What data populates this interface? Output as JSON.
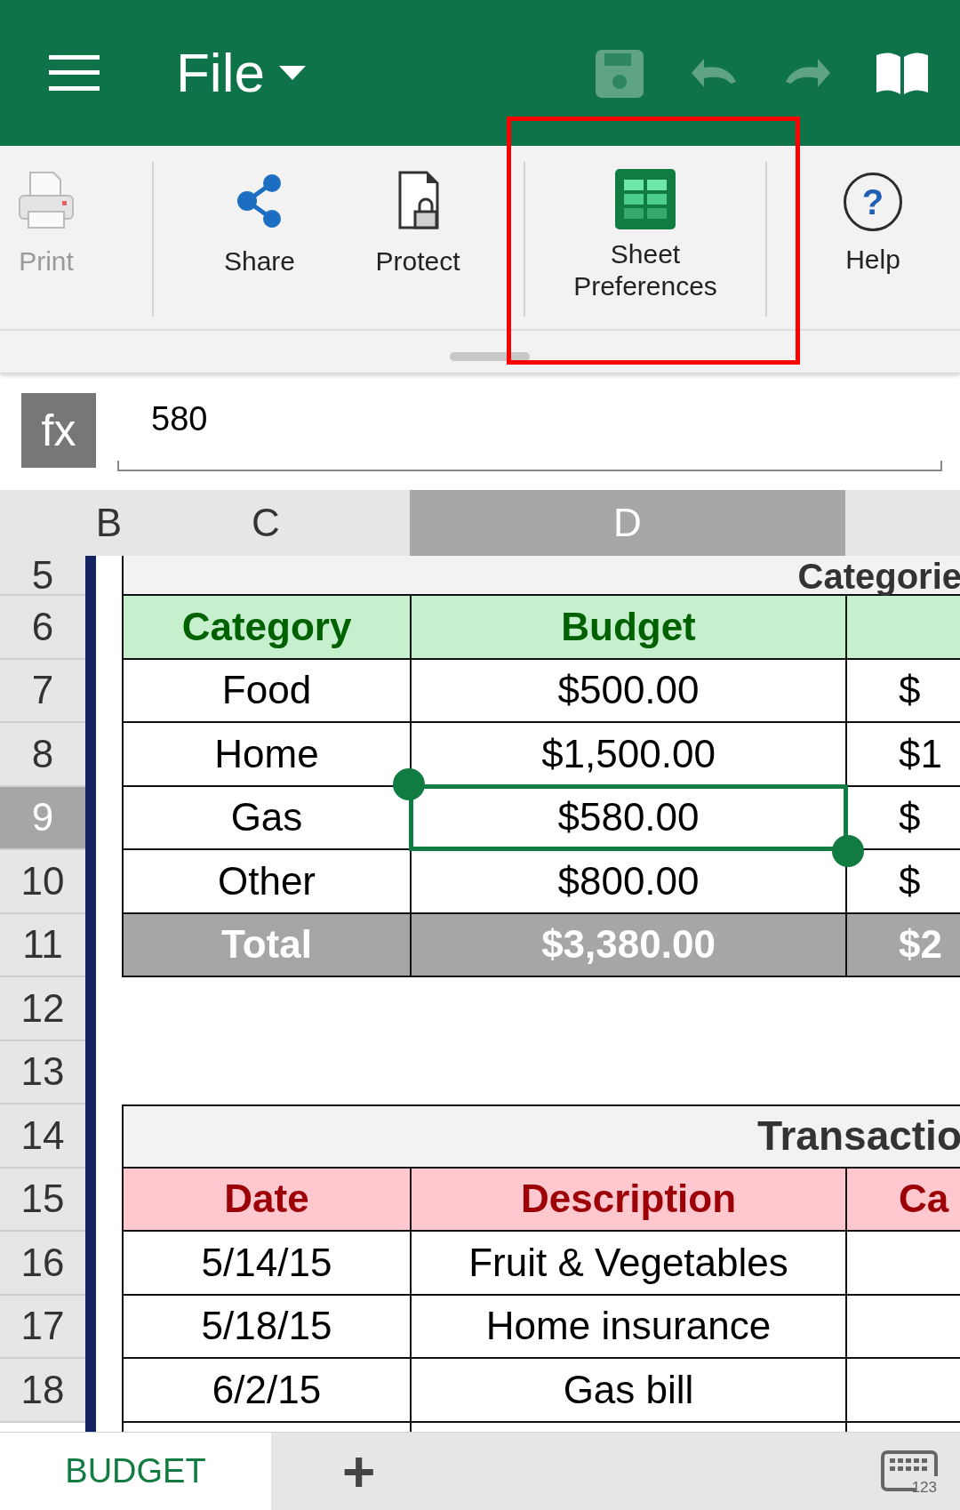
{
  "top_bar": {
    "menu_label": "File",
    "tools": [
      {
        "kind": "save",
        "disabled": true
      },
      {
        "kind": "undo",
        "disabled": true
      },
      {
        "kind": "redo",
        "disabled": true
      },
      {
        "kind": "book",
        "disabled": false
      }
    ]
  },
  "ribbon": {
    "items": [
      {
        "kind": "print",
        "label": "Print",
        "disabled": true,
        "highlighted": false,
        "divider_after": true
      },
      {
        "kind": "share",
        "label": "Share",
        "disabled": false,
        "highlighted": false,
        "divider_after": false
      },
      {
        "kind": "protect",
        "label": "Protect",
        "disabled": false,
        "highlighted": false,
        "divider_after": true
      },
      {
        "kind": "sheet",
        "label": "Sheet Preferences",
        "disabled": false,
        "highlighted": true,
        "divider_after": true
      },
      {
        "kind": "help",
        "label": "Help",
        "glyph": "?",
        "disabled": false,
        "highlighted": false,
        "divider_after": false
      }
    ]
  },
  "formula_bar": {
    "button": "fx",
    "value": "580"
  },
  "sheet": {
    "columns": [
      {
        "label": "B",
        "selected": false
      },
      {
        "label": "C",
        "selected": false
      },
      {
        "label": "D",
        "selected": true
      }
    ],
    "rows": [
      {
        "number": "5",
        "selected": false,
        "kind": "title",
        "title": "Categorie"
      },
      {
        "number": "6",
        "selected": false,
        "kind": "header",
        "color": "#c6efce",
        "cells": [
          "Category",
          "Budget"
        ]
      },
      {
        "number": "7",
        "selected": false,
        "kind": "data",
        "cells": [
          "Food",
          "$500.00",
          "$"
        ]
      },
      {
        "number": "8",
        "selected": false,
        "kind": "data",
        "cells": [
          "Home",
          "$1,500.00",
          "$1"
        ]
      },
      {
        "number": "9",
        "selected": true,
        "kind": "data",
        "cells": [
          "Gas",
          "$580.00",
          "$"
        ]
      },
      {
        "number": "10",
        "selected": false,
        "kind": "data",
        "cells": [
          "Other",
          "$800.00",
          "$"
        ]
      },
      {
        "number": "11",
        "selected": false,
        "kind": "total",
        "cells": [
          "Total",
          "$3,380.00",
          "$2"
        ]
      },
      {
        "number": "12",
        "selected": false,
        "kind": "empty"
      },
      {
        "number": "13",
        "selected": false,
        "kind": "empty"
      },
      {
        "number": "14",
        "selected": false,
        "kind": "title",
        "title": "Transactio"
      },
      {
        "number": "15",
        "selected": false,
        "kind": "header",
        "color": "#ffc7ce",
        "cells": [
          "Date",
          "Description",
          "Ca"
        ]
      },
      {
        "number": "16",
        "selected": false,
        "kind": "data",
        "cells": [
          "5/14/15",
          "Fruit & Vegetables"
        ]
      },
      {
        "number": "17",
        "selected": false,
        "kind": "data",
        "cells": [
          "5/18/15",
          "Home insurance"
        ]
      },
      {
        "number": "18",
        "selected": false,
        "kind": "data",
        "cells": [
          "6/2/15",
          "Gas bill"
        ]
      }
    ]
  },
  "sheet_tabs": {
    "tabs": [
      {
        "label": "BUDGET",
        "selected": true
      }
    ],
    "add_button": "+",
    "keyboard_label": "123"
  }
}
